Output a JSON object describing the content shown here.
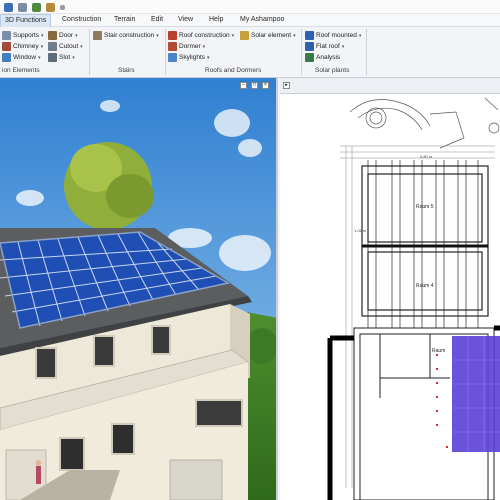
{
  "menu": {
    "tabs": [
      "3D Functions",
      "Construction",
      "Terrain",
      "Edit",
      "View",
      "Help",
      "My Ashampoo"
    ]
  },
  "ribbon": {
    "col1": [
      "Supports",
      "Chimney",
      "Window"
    ],
    "col2": [
      "Door",
      "Cutout",
      "Slot"
    ],
    "col3": [
      "Stair construction"
    ],
    "col4": [
      "Roof construction",
      "Dormer",
      "Skylights"
    ],
    "col5": [
      "Solar element"
    ],
    "col6": [
      "Roof mounted",
      "Flat roof",
      "Analysis"
    ],
    "groups": {
      "g1": "ion Elements",
      "g2": "Stairs",
      "g3": "Roofs and Dormers",
      "g4": "Solar plants"
    }
  },
  "plan": {
    "rooms": {
      "room5": "Raum 5",
      "room4": "Raum 4",
      "room_partial": "Raum"
    },
    "dims": {
      "d1": "0,80 m",
      "d2": "1,02 m"
    }
  },
  "colors": {
    "accent": "#dbe7f4",
    "solar_panel": "#1f4fb5",
    "plan_solar": "#5a3fd6"
  }
}
